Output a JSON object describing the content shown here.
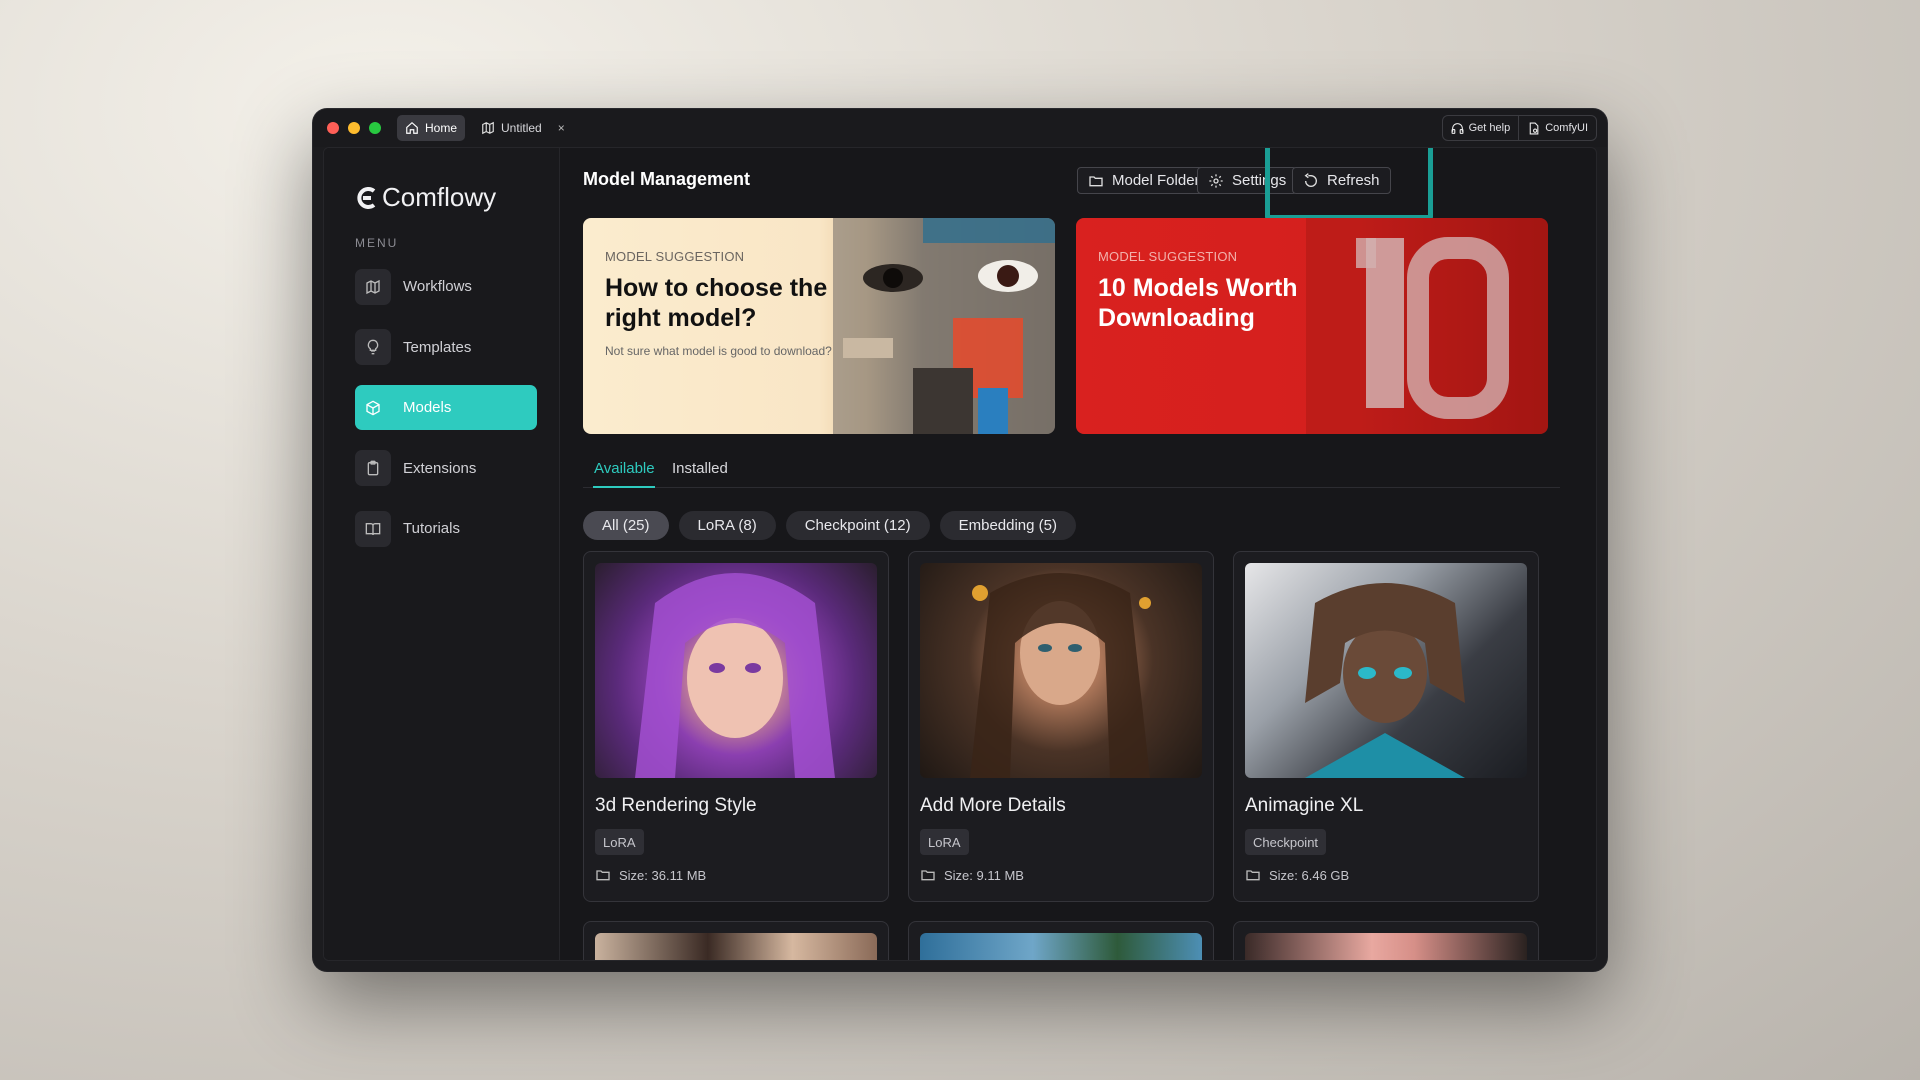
{
  "titlebar": {
    "tabs": [
      {
        "label": "Home",
        "icon": "home-icon"
      },
      {
        "label": "Untitled",
        "icon": "map-icon",
        "close": "×"
      }
    ],
    "get_help": "Get help",
    "comfyui": "ComfyUI"
  },
  "sidebar": {
    "logo": "Comflowy",
    "menu_label": "MENU",
    "items": [
      {
        "label": "Workflows",
        "icon": "map-icon"
      },
      {
        "label": "Templates",
        "icon": "lightbulb-icon"
      },
      {
        "label": "Models",
        "icon": "cube-icon",
        "active": true
      },
      {
        "label": "Extensions",
        "icon": "clipboard-icon"
      },
      {
        "label": "Tutorials",
        "icon": "book-icon"
      }
    ]
  },
  "main": {
    "title": "Model Management",
    "buttons": {
      "model_folder": "Model Folder",
      "settings": "Settings",
      "refresh": "Refresh"
    },
    "banners": [
      {
        "tag": "MODEL SUGGESTION",
        "title": "How to choose the right model?",
        "subtitle": "Not sure what model is good to download?"
      },
      {
        "tag": "MODEL SUGGESTION",
        "title": "10 Models Worth Downloading"
      }
    ],
    "tabs": {
      "available": "Available",
      "installed": "Installed"
    },
    "filters": [
      "All (25)",
      "LoRA (8)",
      "Checkpoint (12)",
      "Embedding (5)"
    ],
    "cards": [
      {
        "title": "3d Rendering Style",
        "type": "LoRA",
        "size": "Size: 36.11 MB"
      },
      {
        "title": "Add More Details",
        "type": "LoRA",
        "size": "Size: 9.11 MB"
      },
      {
        "title": "Animagine XL",
        "type": "Checkpoint",
        "size": "Size: 6.46 GB"
      }
    ]
  },
  "colors": {
    "accent": "#2ecbbf",
    "highlight": "#1a9e95",
    "banner_red": "#d9211f",
    "banner_cream": "#fbecce"
  }
}
